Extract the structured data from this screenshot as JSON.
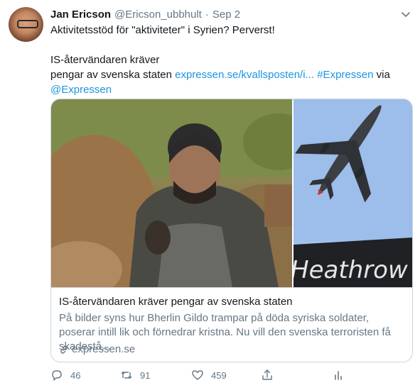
{
  "tweet": {
    "author_name": "Jan Ericson",
    "author_handle": "@Ericson_ubbhult",
    "separator": "·",
    "date": "Sep 2",
    "line1": "Aktivitetsstöd för \"aktiviteter\" i Syrien? Perverst!",
    "line2": "IS-återvändaren kräver",
    "line3_text": "pengar av svenska staten ",
    "line3_link": "expressen.se/kvallsposten/i...",
    "line3_space": " ",
    "line3_hashtag": "#Expressen",
    "line3_via": " via",
    "line4_mention": "@Expressen"
  },
  "card": {
    "image_right_text": "Heathrow",
    "title": "IS-återvändaren kräver pengar av svenska staten",
    "description": "På bilder syns hur Bherlin Gildo trampar på döda syriska soldater, poserar intill lik och förnedrar kristna. Nu vill den svenska terroristen få skadestå...",
    "domain": "expressen.se"
  },
  "actions": {
    "reply_count": "46",
    "retweet_count": "91",
    "like_count": "459"
  },
  "icons": {
    "caret": "chevron-down-icon",
    "reply": "reply-icon",
    "retweet": "retweet-icon",
    "like": "heart-icon",
    "share": "share-icon",
    "analytics": "analytics-icon",
    "link": "link-icon"
  },
  "colors": {
    "link": "#1b95e0",
    "secondary_text": "#657786",
    "border": "#ccd6dd"
  }
}
